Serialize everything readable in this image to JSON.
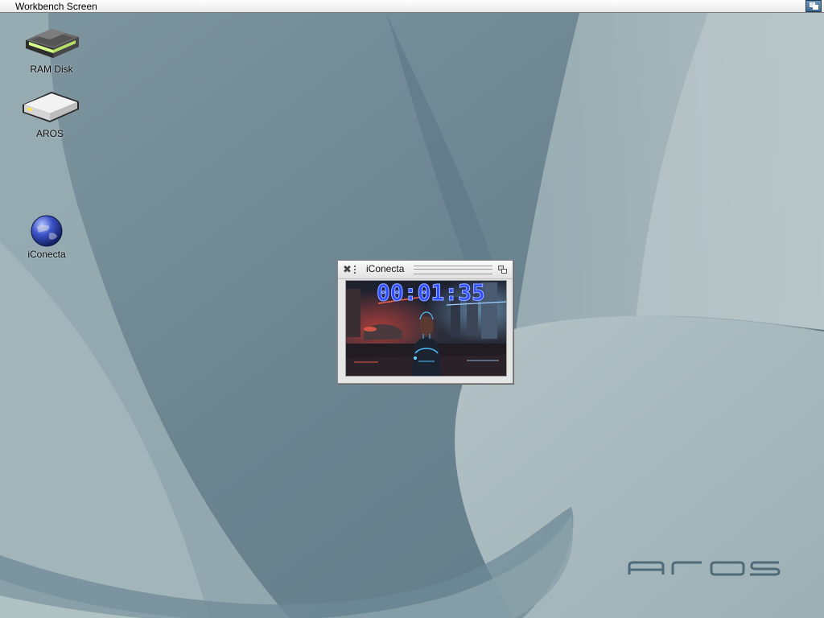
{
  "screen": {
    "title": "Workbench Screen",
    "depth_gadget": "screen-depth-icon"
  },
  "desktop": {
    "icons": [
      {
        "label": "RAM Disk",
        "icon": "ram-disk-drive-icon"
      },
      {
        "label": "AROS",
        "icon": "hard-drive-icon"
      },
      {
        "label": "iConecta",
        "icon": "globe-icon"
      }
    ],
    "logo": "aros-logo"
  },
  "window": {
    "title": "iConecta",
    "close_icon": "close-icon",
    "depth_icon": "window-depth-icon",
    "timer": "00:01:35"
  },
  "colors": {
    "timer_text": "#2d4cff",
    "screenbar_gadget": "#3e6a92",
    "desktop_base": "#8fa3ab"
  }
}
